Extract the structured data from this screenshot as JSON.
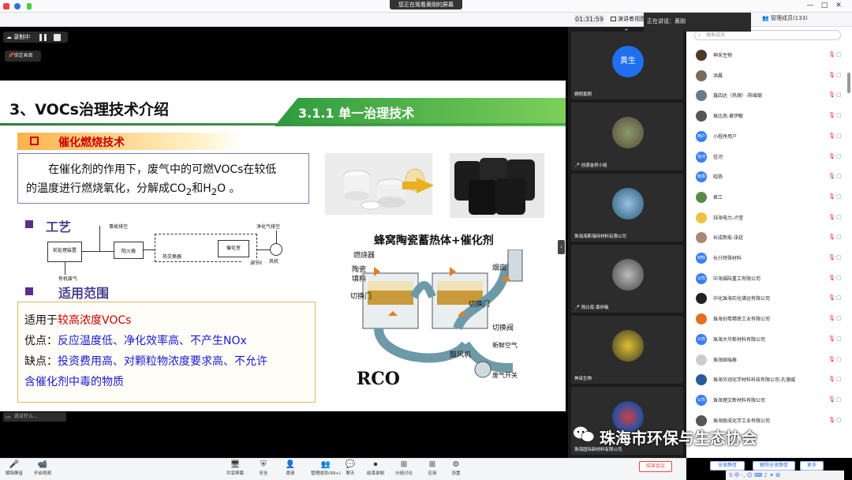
{
  "window": {
    "share_banner": "您正在观看黄刚的屏幕",
    "controls": [
      "—",
      "□",
      "✕"
    ]
  },
  "meeting": {
    "timer": "01:31:59",
    "view_button": "演讲者视图",
    "speaking": "正在讲话：黄刚",
    "members_title": "管理成员(133)"
  },
  "recording": {
    "label": "录制中",
    "lock_screen": "锁定画面"
  },
  "slide": {
    "title": "3、VOCs治理技术介绍",
    "tab": "3.1.1 单一治理技术",
    "heading": "催化燃烧技术",
    "desc_line1": "在催化剂的作用下，废气中的可燃VOCs在较低",
    "desc_line2a": "的温度进行燃烧氧化，分解成CO",
    "desc_sub2": "2",
    "desc_line2b": "和H",
    "desc_sub3": "2",
    "desc_line2c": "O 。",
    "process_heading": "工艺",
    "apply_heading": "适用范围",
    "apply_line1a": "适用于",
    "apply_line1b": "较高浓度VOCs",
    "pros_label": "优点：",
    "pros_text": "反应温度低、净化效率高、不产生NOx",
    "cons_label": "缺点：",
    "cons_text1": "投资费用高、对颗粒物浓度要求高、不允许",
    "cons_text2": "含催化剂中毒的物质",
    "honeycomb_title": "蜂窝陶瓷蓄热体+催化剂",
    "rco_label": "RCO",
    "process_labels": {
      "exhaust": "事故排空",
      "pretreat": "前处理装置",
      "flame": "阻火器",
      "hx": "热交换器",
      "catalyst": "催化室",
      "valve": "调节阀",
      "clean": "净化气排空",
      "fan": "风机",
      "organic": "有机废气"
    },
    "rco_labels": {
      "burner": "燃烧器",
      "ceramic": "陶瓷",
      "catalyst": "填料",
      "switch_left": "切换门",
      "switch_mid": "切换门",
      "switch_right": "切换阀",
      "chimney": "烟囱",
      "fresh_air": "新鲜空气",
      "fan": "鼓风机",
      "waste_gas": "废气开关"
    }
  },
  "chat_input": "说点什么...",
  "video_tiles": [
    {
      "name": "黄刚",
      "avatar_text": "黄生",
      "display_name": "翱翔黄刚"
    },
    {
      "name": "创源金桥小组",
      "avatar_text": ""
    },
    {
      "name": "珠海海斯瑞特材料有限公司",
      "avatar_text": ""
    },
    {
      "name": "珠比南-黄伊敏",
      "avatar_text": ""
    },
    {
      "name": "神采生物",
      "avatar_text": ""
    },
    {
      "name": "珠海国际新材料有限公司",
      "avatar_text": ""
    }
  ],
  "members": {
    "search_placeholder": "搜索成员",
    "list": [
      {
        "name": "神采生物",
        "avatar": "",
        "color": "#4a3a2a"
      },
      {
        "name": "洪晨",
        "avatar": "",
        "color": "#7a6a5a"
      },
      {
        "name": "鑫四达（热熔）-陈峻聪",
        "avatar": "",
        "color": "#6a7a8a"
      },
      {
        "name": "珠比南-黄伊敏",
        "avatar": "",
        "color": "#555555"
      },
      {
        "name": "小程序用户",
        "avatar": "用户",
        "color": "#3a7ff0"
      },
      {
        "name": "信河",
        "avatar": "信河",
        "color": "#3a7ff0"
      },
      {
        "name": "晓扬",
        "avatar": "晓扬",
        "color": "#3a7ff0"
      },
      {
        "name": "君工",
        "avatar": "",
        "color": "#5a8a4a"
      },
      {
        "name": "钰海电力-卢莹",
        "avatar": "",
        "color": "#f0c040"
      },
      {
        "name": "长成新能-张廷",
        "avatar": "",
        "color": "#aa8877"
      },
      {
        "name": "长兴特殊材料",
        "avatar": "材料",
        "color": "#3a7ff0"
      },
      {
        "name": "中海福陆重工有限公司",
        "avatar": "公司",
        "color": "#3a7ff0"
      },
      {
        "name": "中化珠海石化储运有限公司",
        "avatar": "",
        "color": "#222222"
      },
      {
        "name": "珠海创粤精密工业有限公司",
        "avatar": "",
        "color": "#e07020"
      },
      {
        "name": "珠海大华新材料有限公司",
        "avatar": "公司",
        "color": "#3a7ff0"
      },
      {
        "name": "珠海国瑞泰",
        "avatar": "",
        "color": "#cccccc"
      },
      {
        "name": "珠海华润化学材料科技有限公司-孔德威",
        "avatar": "",
        "color": "#2a5a9a"
      },
      {
        "name": "珠海理文新材料有限公司",
        "avatar": "公司",
        "color": "#3a7ff0"
      },
      {
        "name": "珠海联成化学工业有限公司",
        "avatar": "",
        "color": "#555555"
      }
    ],
    "buttons": [
      "全体静音",
      "解除全体静音",
      "更多"
    ]
  },
  "toolbar": [
    {
      "label": "解除静音",
      "icon": "mic-muted-icon",
      "glyph": "🎤"
    },
    {
      "label": "开启视频",
      "icon": "camera-off-icon",
      "glyph": "📹"
    },
    {
      "label": "共享屏幕",
      "icon": "share-screen-icon",
      "glyph": "🖥"
    },
    {
      "label": "安全",
      "icon": "shield-icon",
      "glyph": "⛨"
    },
    {
      "label": "邀请",
      "icon": "invite-icon",
      "glyph": "👤"
    },
    {
      "label": "管理成员(99+)",
      "icon": "members-icon",
      "glyph": "👥"
    },
    {
      "label": "聊天",
      "icon": "chat-icon",
      "glyph": "💬"
    },
    {
      "label": "结束录制",
      "icon": "record-icon",
      "glyph": "⏺"
    },
    {
      "label": "分组讨论",
      "icon": "breakout-icon",
      "glyph": "⊞"
    },
    {
      "label": "应用",
      "icon": "apps-icon",
      "glyph": "⊞"
    },
    {
      "label": "设置",
      "icon": "settings-icon",
      "glyph": "⚙"
    }
  ],
  "leave_button": "结束会议",
  "watermark": "珠海市环保与生态协会",
  "ime_bar": "S 中 ·, ☺ ⌨ ♪ ✦ ⊞"
}
